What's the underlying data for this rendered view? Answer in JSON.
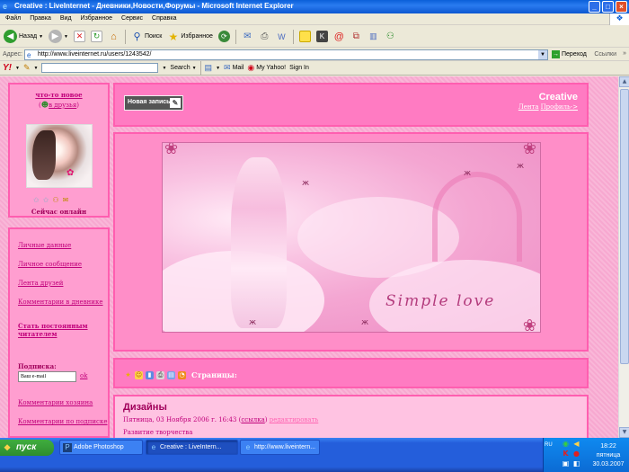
{
  "window": {
    "title": "Creative : LiveInternet - Дневники,Новости,Форумы - Microsoft Internet Explorer",
    "buttons": [
      "_",
      "□",
      "×"
    ]
  },
  "menu": {
    "items": [
      "Файл",
      "Правка",
      "Вид",
      "Избранное",
      "Сервис",
      "Справка"
    ]
  },
  "toolbar": {
    "back_label": "Назад",
    "search_label": "Поиск",
    "favorites_label": "Избранное"
  },
  "address": {
    "label": "Адрес:",
    "url": "http://www.liveinternet.ru/users/1243542/",
    "go_label": "Переход",
    "links_label": "Ссылки"
  },
  "yahoo": {
    "search_label": "Search",
    "mail_label": "Mail",
    "my_yahoo_label": "My Yahoo!",
    "signin_label": "Sign In"
  },
  "sidebar": {
    "whats_new": "что-то новое",
    "add_friend": "в друзья",
    "online_status": "Сейчас онлайн",
    "menu_links": [
      {
        "label": "Личные данные"
      },
      {
        "label": "Личное сообщение"
      },
      {
        "label": "Лента друзей"
      },
      {
        "label": "Комментарии в дневнике"
      },
      {
        "label": "Стать постоянным читателем"
      }
    ],
    "subscribe_label": "Подписка:",
    "email_placeholder": "Ваш e-mail",
    "ok_label": "ok",
    "bottom_links": [
      {
        "label": "Комментарии хозяина"
      },
      {
        "label": "Комментарии по подписке"
      }
    ]
  },
  "header": {
    "new_entry_label": "Новая запись",
    "blog_title": "Creative",
    "feed_link": "Лента",
    "profile_link": "Профиль->"
  },
  "banner": {
    "script_text": "Simple love"
  },
  "pager": {
    "pages_label": "Страницы:"
  },
  "post": {
    "title": "Дизайны",
    "date": "Пятница, 03 Ноября 2006 г. 16:43",
    "link_open": "(",
    "link_label": "ссылка",
    "link_close": ")",
    "edit_label": "редактировать",
    "body": "Развитие творчества"
  },
  "taskbar": {
    "start_label": "пуск",
    "tasks": [
      {
        "label": "Adobe Photoshop"
      },
      {
        "label": "Creative : LiveIntern..."
      },
      {
        "label": "http://www.liveintern..."
      }
    ],
    "lang": "RU",
    "time": "18:22",
    "day": "пятница",
    "date": "30.03.2007"
  },
  "colors": {
    "accent_pink": "#ff5eb0",
    "link_pink": "#c0007a",
    "xp_blue": "#245edb"
  }
}
